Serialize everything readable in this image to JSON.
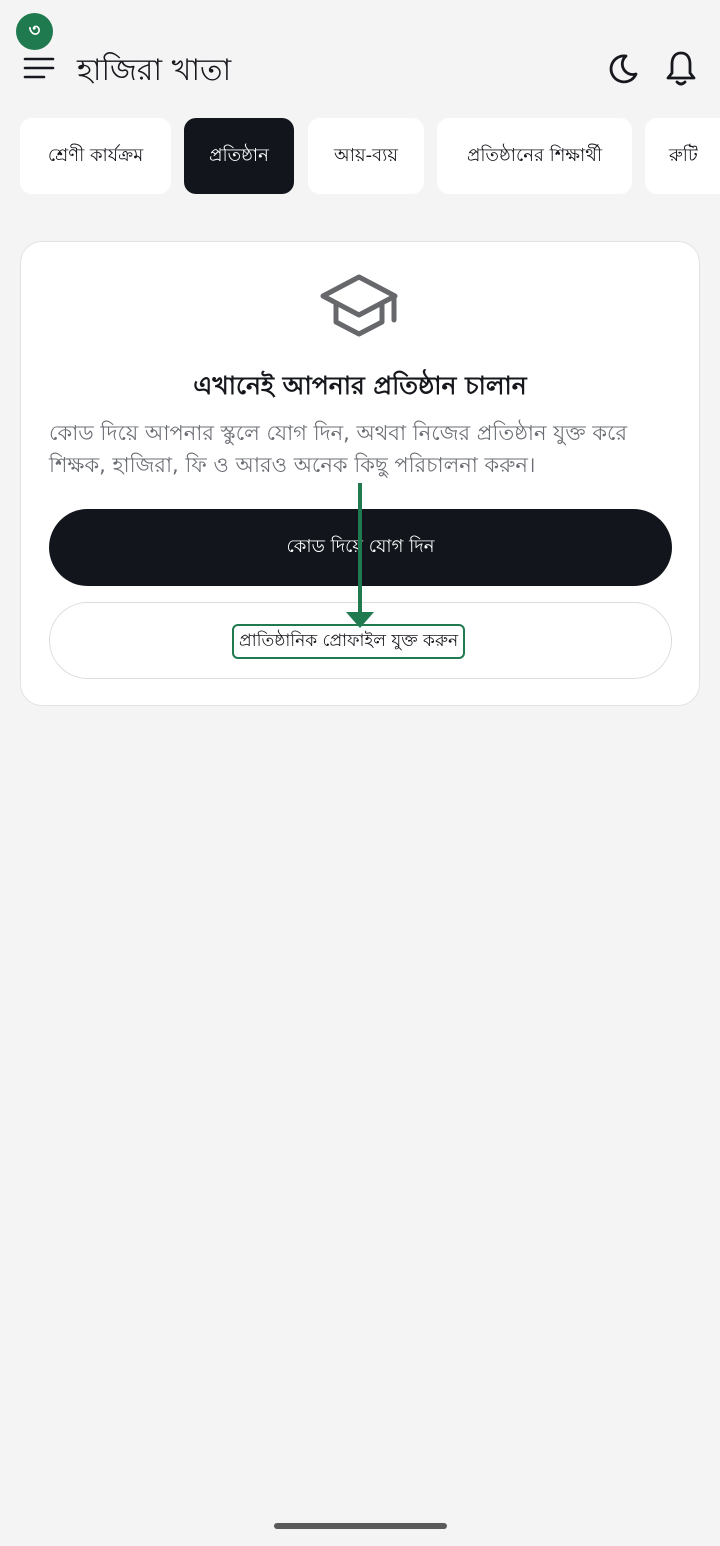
{
  "step_badge": "৩",
  "header": {
    "title": "হাজিরা খাতা",
    "icons": [
      "hamburger-menu-icon",
      "moon-icon",
      "bell-icon"
    ]
  },
  "tabs": [
    {
      "label": "শ্রেণী কার্যক্রম",
      "active": false
    },
    {
      "label": "প্রতিষ্ঠান",
      "active": true
    },
    {
      "label": "আয়-ব্যয়",
      "active": false
    },
    {
      "label": "প্রতিষ্ঠানের শিক্ষার্থী",
      "active": false
    },
    {
      "label": "রুটি",
      "active": false
    }
  ],
  "card": {
    "icon": "graduation-cap-icon",
    "title": "এখানেই আপনার প্রতিষ্ঠান চালান",
    "description": "কোড দিয়ে আপনার স্কুলে যোগ দিন, অথবা নিজের প্রতিষ্ঠান যুক্ত করে শিক্ষক, হাজিরা, ফি ও আরও অনেক কিছু পরিচালনা করুন।",
    "join_button": "কোড দিয়ে যোগ দিন",
    "add_profile_button": "প্রাতিষ্ঠানিক প্রোফাইল যুক্ত করুন"
  },
  "colors": {
    "accent_green": "#1f7a4f",
    "dark": "#12161c",
    "background": "#f4f4f4"
  }
}
